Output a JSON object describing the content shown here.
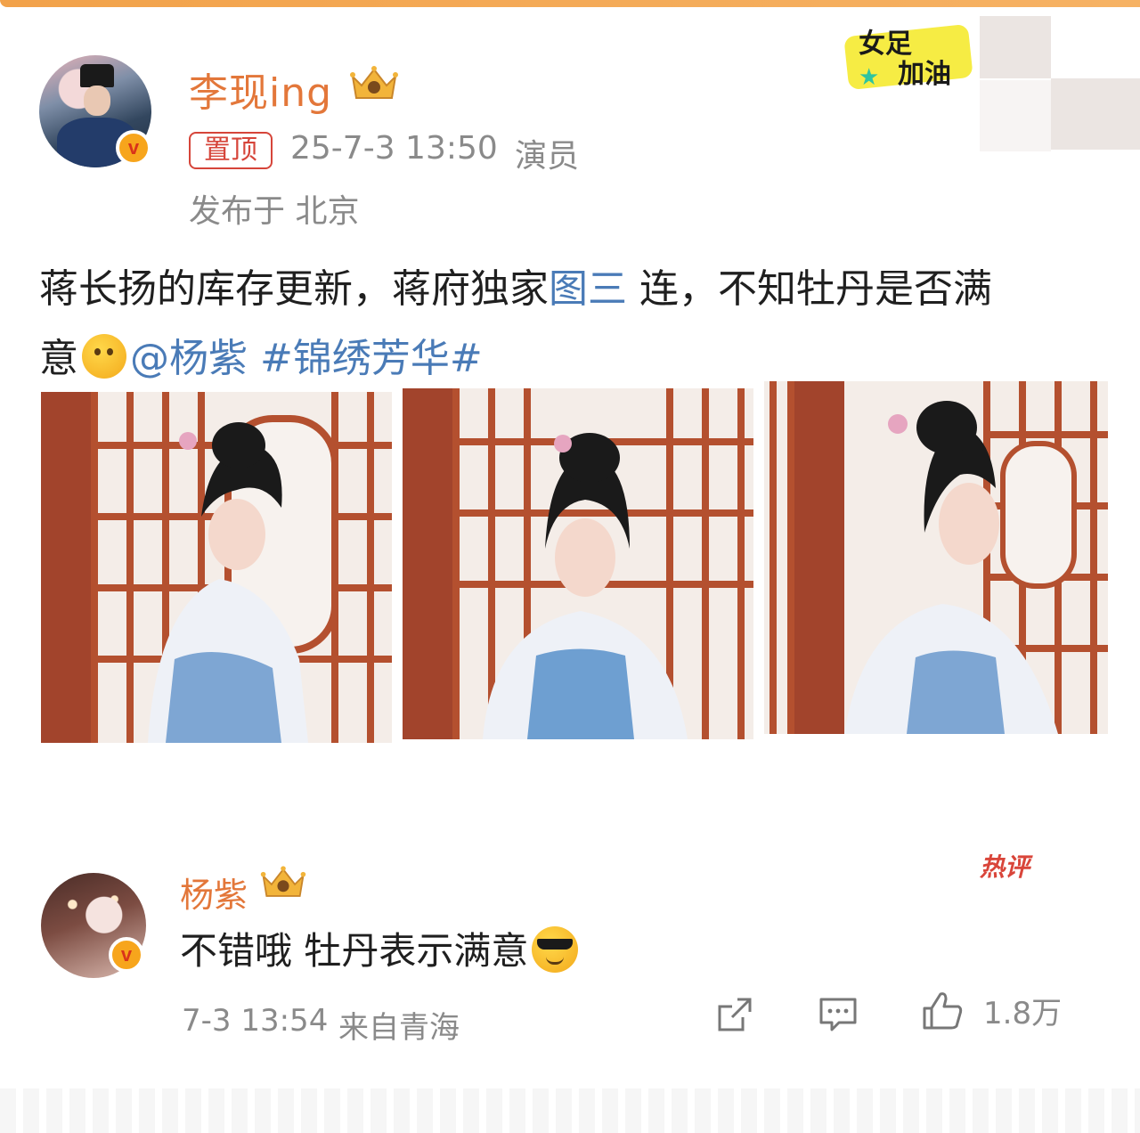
{
  "post": {
    "username": "李现ing",
    "pinned_label": "置顶",
    "time": "25-7-3 13:50",
    "role": "演员",
    "location": "发布于 北京",
    "text_part1": "蒋长扬的库存更新，蒋府独家",
    "link_images": "图三",
    "text_part2": " 连，不知牡丹是否满",
    "text_line2_start": "意",
    "mention": "@杨紫",
    "hashtag": " #锦绣芳华#"
  },
  "sticker": {
    "line1": "女足",
    "line2": "加油"
  },
  "comment": {
    "username": "杨紫",
    "hot_label": "热评",
    "text": "不错哦 牡丹表示满意",
    "time": "7-3 13:54",
    "location": "来自青海",
    "like_count": "1.8万"
  },
  "icons": {
    "pin": "pin-badge",
    "verified": "verified-v-icon",
    "crown": "crown-icon",
    "share": "share-icon",
    "comment": "comment-icon",
    "like": "thumbs-up-icon"
  },
  "colors": {
    "username": "#e3773a",
    "link": "#4a7bb7",
    "meta": "#8a8a8a",
    "pinned": "#d6453a",
    "hot": "#d9453a"
  }
}
